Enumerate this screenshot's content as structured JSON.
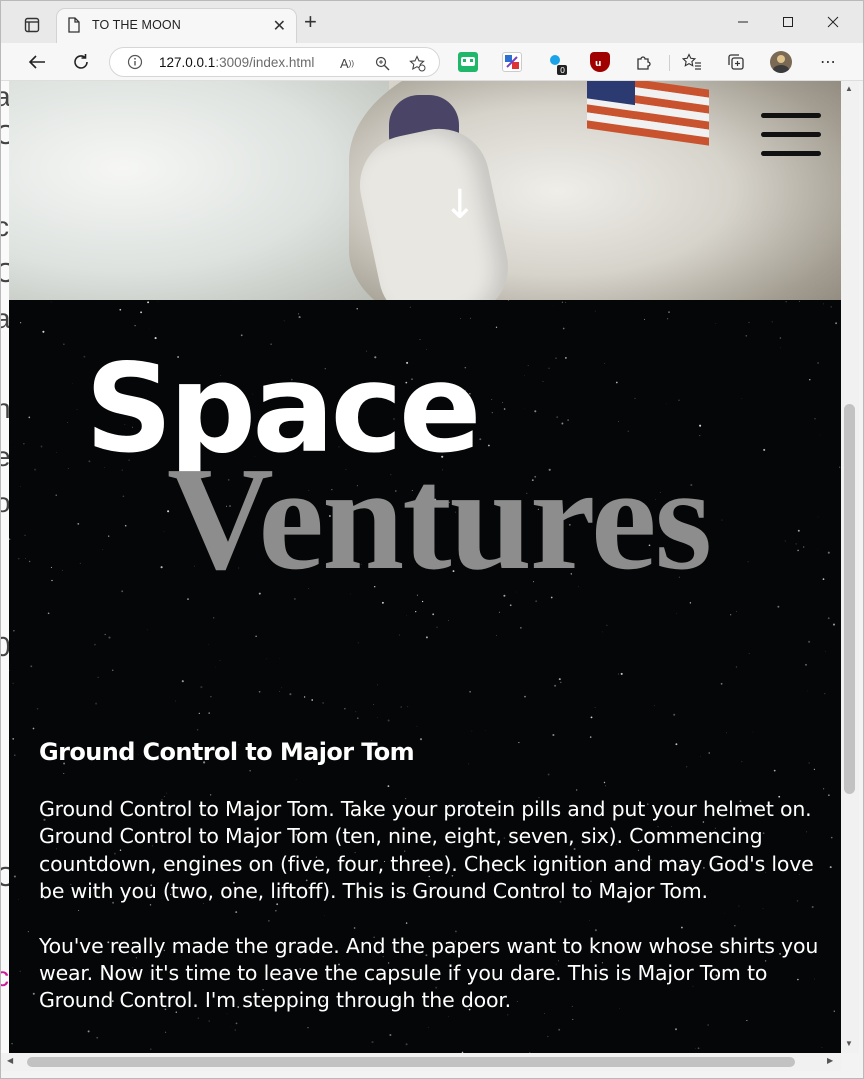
{
  "browser": {
    "tab": {
      "title": "TO THE MOON"
    },
    "address": {
      "host": "127.0.0.1",
      "rest": ":3009/index.html"
    }
  },
  "hero": {
    "scroll_hint_icon": "arrow-down-icon",
    "menu_icon": "hamburger-menu-icon"
  },
  "brand": {
    "word1": "Space",
    "word2": "Ventures"
  },
  "article": {
    "heading": "Ground Control to Major Tom",
    "paragraphs": [
      "Ground Control to Major Tom. Take your protein pills and put your helmet on. Ground Control to Major Tom (ten, nine, eight, seven, six). Commencing countdown, engines on (five, four, three). Check ignition and may God's love be with you (two, one, liftoff). This is Ground Control to Major Tom.",
      "You've really made the grade. And the papers want to know whose shirts you wear. Now it's time to leave the capsule if you dare. This is Major Tom to Ground Control. I'm stepping through the door."
    ]
  },
  "colors": {
    "page_bg": "#050607",
    "title_white": "#ffffff",
    "title_grey": "#8d8d8d",
    "chrome_bg": "#f7f7f7"
  }
}
